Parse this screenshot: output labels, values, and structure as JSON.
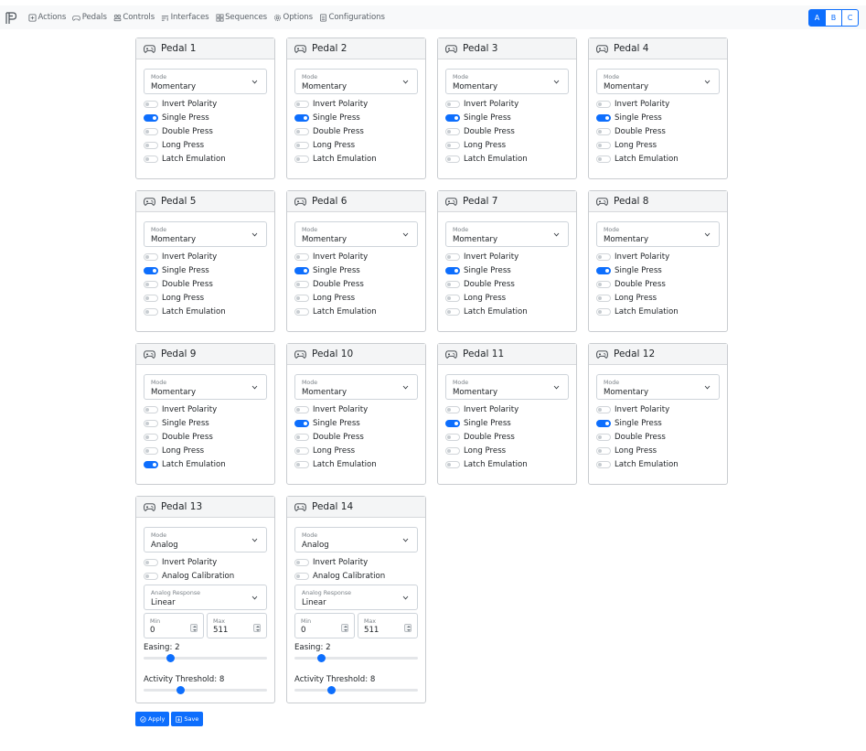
{
  "nav": {
    "items": [
      {
        "label": "Actions",
        "icon": "plus-square-icon"
      },
      {
        "label": "Pedals",
        "icon": "gamepad-icon"
      },
      {
        "label": "Controls",
        "icon": "controls-icon"
      },
      {
        "label": "Interfaces",
        "icon": "interfaces-icon"
      },
      {
        "label": "Sequences",
        "icon": "sequences-icon"
      },
      {
        "label": "Options",
        "icon": "gear-icon"
      },
      {
        "label": "Configurations",
        "icon": "list-icon"
      }
    ],
    "groups": [
      "A",
      "B",
      "C"
    ],
    "active_group": "A"
  },
  "labels": {
    "mode": "Mode",
    "invert_polarity": "Invert Polarity",
    "single_press": "Single Press",
    "double_press": "Double Press",
    "long_press": "Long Press",
    "latch_emulation": "Latch Emulation",
    "analog_calibration": "Analog Calibration",
    "analog_response": "Analog Response",
    "min": "Min",
    "max": "Max"
  },
  "pedals": [
    {
      "title": "Pedal 1",
      "mode": "Momentary",
      "invert": false,
      "single": true,
      "double": false,
      "long": false,
      "latch": false
    },
    {
      "title": "Pedal 2",
      "mode": "Momentary",
      "invert": false,
      "single": true,
      "double": false,
      "long": false,
      "latch": false
    },
    {
      "title": "Pedal 3",
      "mode": "Momentary",
      "invert": false,
      "single": true,
      "double": false,
      "long": false,
      "latch": false
    },
    {
      "title": "Pedal 4",
      "mode": "Momentary",
      "invert": false,
      "single": true,
      "double": false,
      "long": false,
      "latch": false
    },
    {
      "title": "Pedal 5",
      "mode": "Momentary",
      "invert": false,
      "single": true,
      "double": false,
      "long": false,
      "latch": false
    },
    {
      "title": "Pedal 6",
      "mode": "Momentary",
      "invert": false,
      "single": true,
      "double": false,
      "long": false,
      "latch": false
    },
    {
      "title": "Pedal 7",
      "mode": "Momentary",
      "invert": false,
      "single": true,
      "double": false,
      "long": false,
      "latch": false
    },
    {
      "title": "Pedal 8",
      "mode": "Momentary",
      "invert": false,
      "single": true,
      "double": false,
      "long": false,
      "latch": false
    },
    {
      "title": "Pedal 9",
      "mode": "Momentary",
      "invert": false,
      "single": false,
      "double": false,
      "long": false,
      "latch": true
    },
    {
      "title": "Pedal 10",
      "mode": "Momentary",
      "invert": false,
      "single": true,
      "double": false,
      "long": false,
      "latch": false
    },
    {
      "title": "Pedal 11",
      "mode": "Momentary",
      "invert": false,
      "single": true,
      "double": false,
      "long": false,
      "latch": false
    },
    {
      "title": "Pedal 12",
      "mode": "Momentary",
      "invert": false,
      "single": true,
      "double": false,
      "long": false,
      "latch": false
    },
    {
      "title": "Pedal 13",
      "mode": "Analog",
      "invert": false,
      "calibration": false,
      "response": "Linear",
      "min": "0",
      "max": "511",
      "easing": "Easing: 2",
      "easing_value": 2,
      "threshold": "Activity Threshold: 8",
      "threshold_value": 8
    },
    {
      "title": "Pedal 14",
      "mode": "Analog",
      "invert": false,
      "calibration": false,
      "response": "Linear",
      "min": "0",
      "max": "511",
      "easing": "Easing: 2",
      "easing_value": 2,
      "threshold": "Activity Threshold: 8",
      "threshold_value": 8
    }
  ],
  "actions": {
    "apply": "Apply",
    "save": "Save"
  },
  "colors": {
    "accent": "#0d6efd",
    "navbar_bg": "#f8f9fa",
    "card_header_bg": "#f4f5f6"
  }
}
